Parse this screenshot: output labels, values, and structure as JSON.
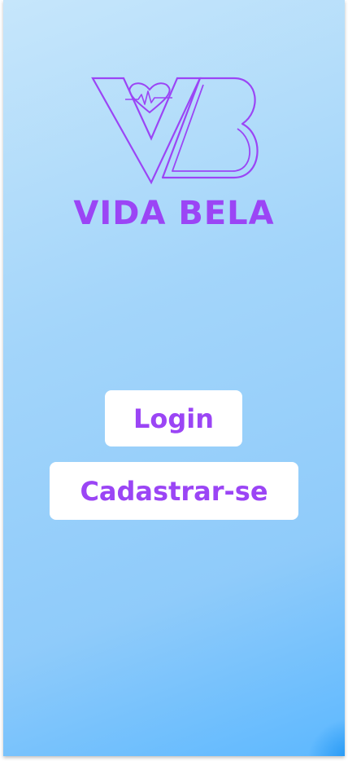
{
  "brand": {
    "name": "VIDA BELA",
    "logo_icon": "vb-heart-logo-icon",
    "accent_color": "#9b45f5"
  },
  "actions": {
    "login_label": "Login",
    "register_label": "Cadastrar-se"
  },
  "background": {
    "gradient_start": "#c6e6fb",
    "gradient_end": "#5db8ff"
  }
}
